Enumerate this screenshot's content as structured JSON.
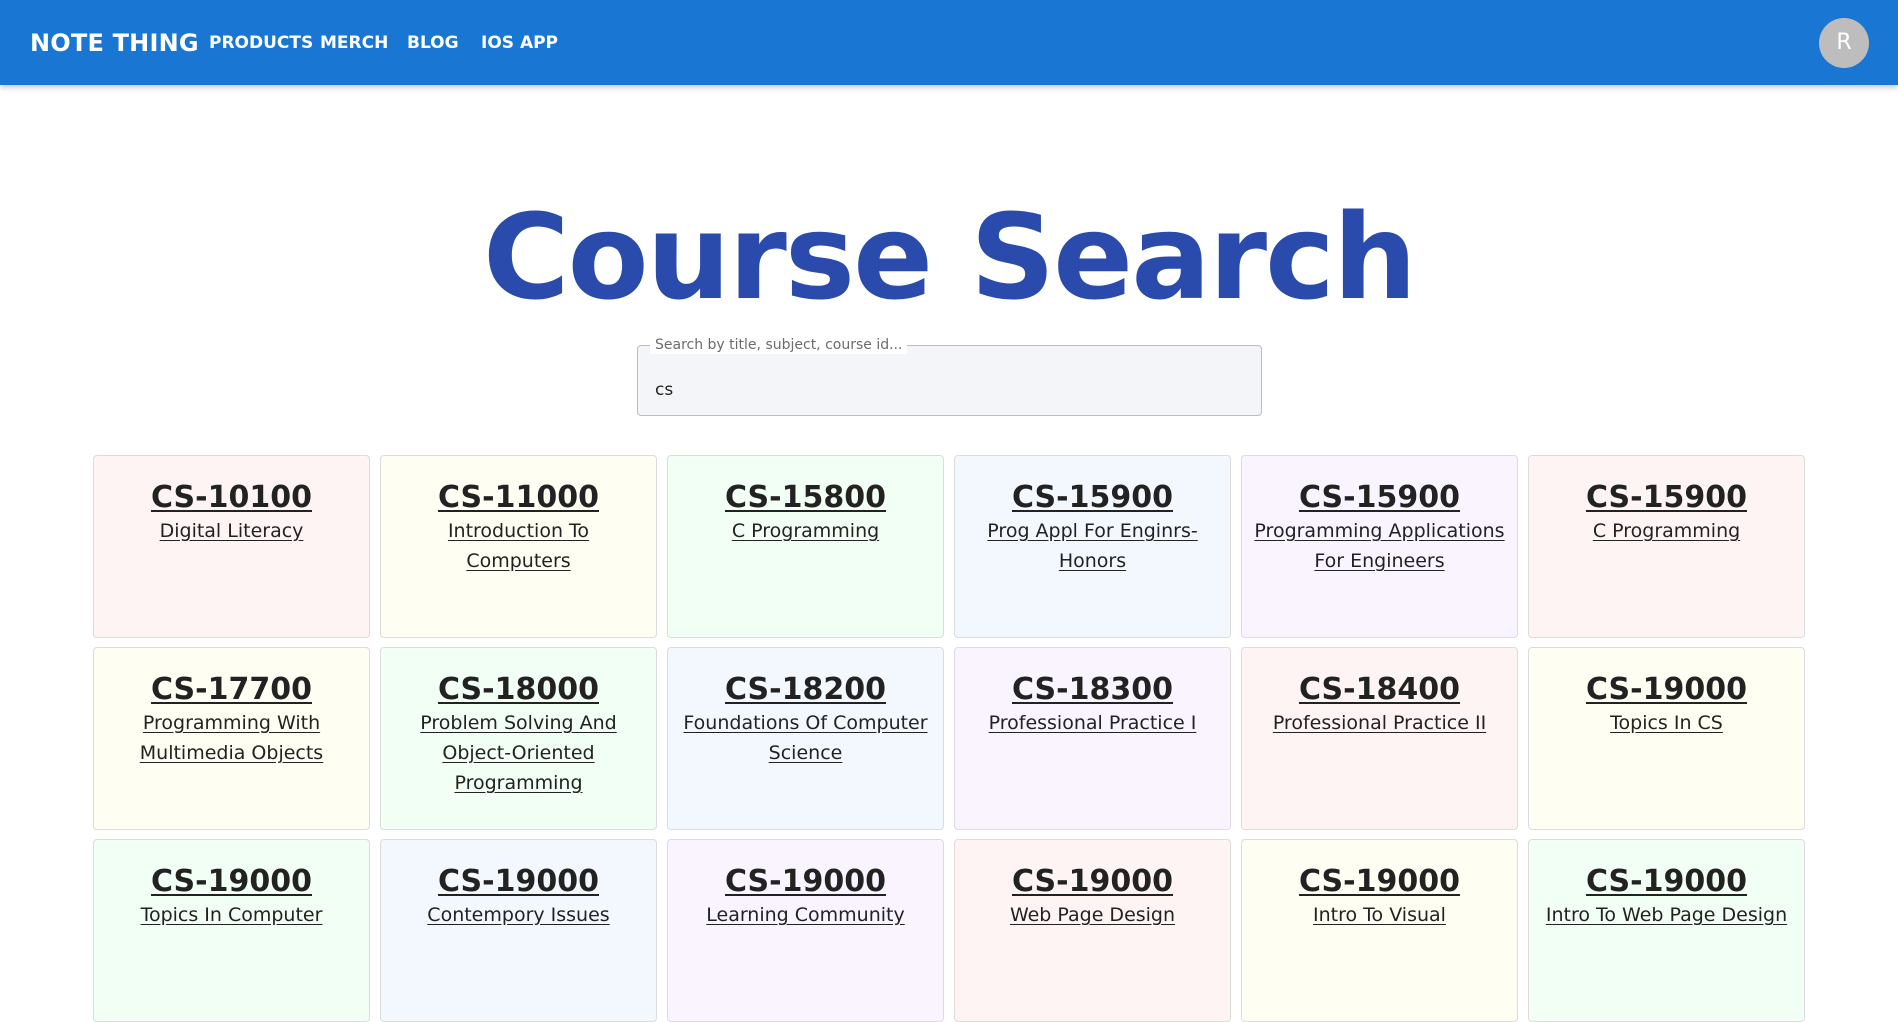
{
  "nav": {
    "brand": "NOTE THING",
    "links": [
      "PRODUCTS",
      "MERCH",
      "BLOG",
      "IOS APP"
    ],
    "avatar_initial": "R"
  },
  "page": {
    "title": "Course Search"
  },
  "search": {
    "label": "Search by title, subject, course id...",
    "value": "cs"
  },
  "courses": [
    {
      "id": "CS-10100",
      "title": "Digital Literacy"
    },
    {
      "id": "CS-11000",
      "title": "Introduction To Computers"
    },
    {
      "id": "CS-15800",
      "title": "C Programming"
    },
    {
      "id": "CS-15900",
      "title": "Prog Appl For Enginrs-Honors"
    },
    {
      "id": "CS-15900",
      "title": "Programming Applications For Engineers"
    },
    {
      "id": "CS-15900",
      "title": "C Programming"
    },
    {
      "id": "CS-17700",
      "title": "Programming With Multimedia Objects"
    },
    {
      "id": "CS-18000",
      "title": "Problem Solving And Object-Oriented Programming"
    },
    {
      "id": "CS-18200",
      "title": "Foundations Of Computer Science"
    },
    {
      "id": "CS-18300",
      "title": "Professional Practice I"
    },
    {
      "id": "CS-18400",
      "title": "Professional Practice II"
    },
    {
      "id": "CS-19000",
      "title": "Topics In CS"
    },
    {
      "id": "CS-19000",
      "title": "Topics In Computer"
    },
    {
      "id": "CS-19000",
      "title": "Contempory Issues"
    },
    {
      "id": "CS-19000",
      "title": "Learning Community"
    },
    {
      "id": "CS-19000",
      "title": "Web Page Design"
    },
    {
      "id": "CS-19000",
      "title": "Intro To Visual"
    },
    {
      "id": "CS-19000",
      "title": "Intro To Web Page Design"
    }
  ],
  "colors": {
    "navbar": "#1976d2",
    "title": "#2a4bab",
    "card_backgrounds": [
      "#fff4f4",
      "#fffef2",
      "#f2fff5",
      "#f3f8ff",
      "#f9f4ff"
    ]
  }
}
